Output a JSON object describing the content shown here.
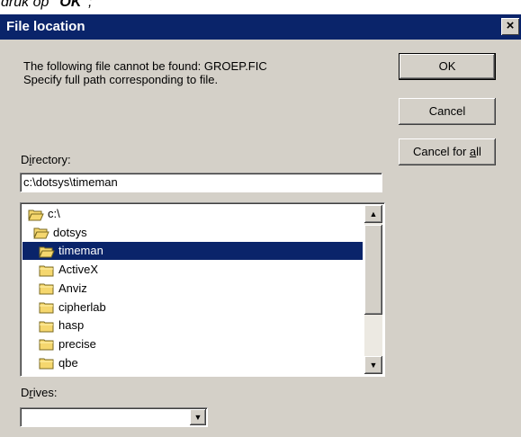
{
  "caption": {
    "prefix": "druk op ",
    "bold": "\"OK\"",
    "suffix": ";"
  },
  "dialog": {
    "title": "File location",
    "close_label": "×",
    "message_line1": "The following file cannot be found: GROEP.FIC",
    "message_line2": "Specify full path corresponding to file.",
    "buttons": {
      "ok": "OK",
      "cancel": "Cancel",
      "cancel_all": "Cancel for all"
    },
    "directory_label": "Directory:",
    "directory_value": "c:\\dotsys\\timeman",
    "folders": [
      {
        "name": "c:\\",
        "open": true,
        "selected": false
      },
      {
        "name": "dotsys",
        "open": true,
        "selected": false
      },
      {
        "name": "timeman",
        "open": true,
        "selected": true
      },
      {
        "name": "ActiveX",
        "open": false,
        "selected": false
      },
      {
        "name": "Anviz",
        "open": false,
        "selected": false
      },
      {
        "name": "cipherlab",
        "open": false,
        "selected": false
      },
      {
        "name": "hasp",
        "open": false,
        "selected": false
      },
      {
        "name": "precise",
        "open": false,
        "selected": false
      },
      {
        "name": "qbe",
        "open": false,
        "selected": false
      }
    ],
    "drives_label": "Drives:",
    "drives_value": ""
  },
  "colors": {
    "titlebar": "#0a246a",
    "face": "#d4d0c8",
    "folder": "#f5d76e"
  }
}
